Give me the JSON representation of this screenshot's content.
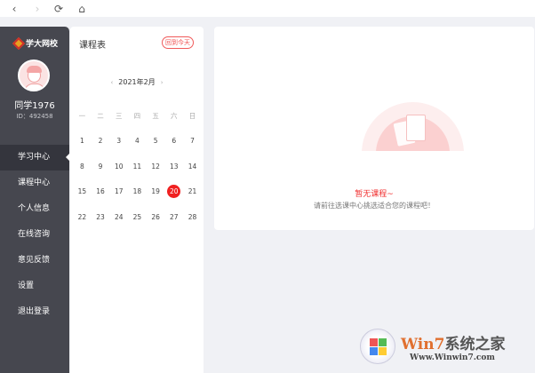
{
  "toolbar": {
    "back": "‹",
    "forward": "›",
    "refresh": "⟳",
    "home": "⌂"
  },
  "sidebar": {
    "logo_text": "学大网校",
    "user_name": "同学1976",
    "user_id": "ID：492458",
    "items": [
      {
        "label": "学习中心",
        "active": true
      },
      {
        "label": "课程中心"
      },
      {
        "label": "个人信息"
      },
      {
        "label": "在线咨询"
      },
      {
        "label": "意见反馈"
      },
      {
        "label": "设置"
      },
      {
        "label": "退出登录"
      }
    ]
  },
  "calendar": {
    "title": "课程表",
    "today_button": "回到今天",
    "month": "2021年2月",
    "prev": "‹",
    "next": "›",
    "weekdays": [
      "一",
      "二",
      "三",
      "四",
      "五",
      "六",
      "日"
    ],
    "weeks": [
      [
        "1",
        "2",
        "3",
        "4",
        "5",
        "6",
        "7"
      ],
      [
        "8",
        "9",
        "10",
        "11",
        "12",
        "13",
        "14"
      ],
      [
        "15",
        "16",
        "17",
        "18",
        "19",
        "20",
        "21"
      ],
      [
        "22",
        "23",
        "24",
        "25",
        "26",
        "27",
        "28"
      ]
    ],
    "selected": "20"
  },
  "courses": {
    "empty_title": "暂无课程~",
    "empty_subtitle": "请前往选课中心挑选适合您的课程吧！"
  },
  "watermark": {
    "title_a": "Win7",
    "title_b": "系统之家",
    "url": "Www.Winwin7.com"
  },
  "colors": {
    "accent": "#f02020",
    "sidebar": "#46474f"
  }
}
